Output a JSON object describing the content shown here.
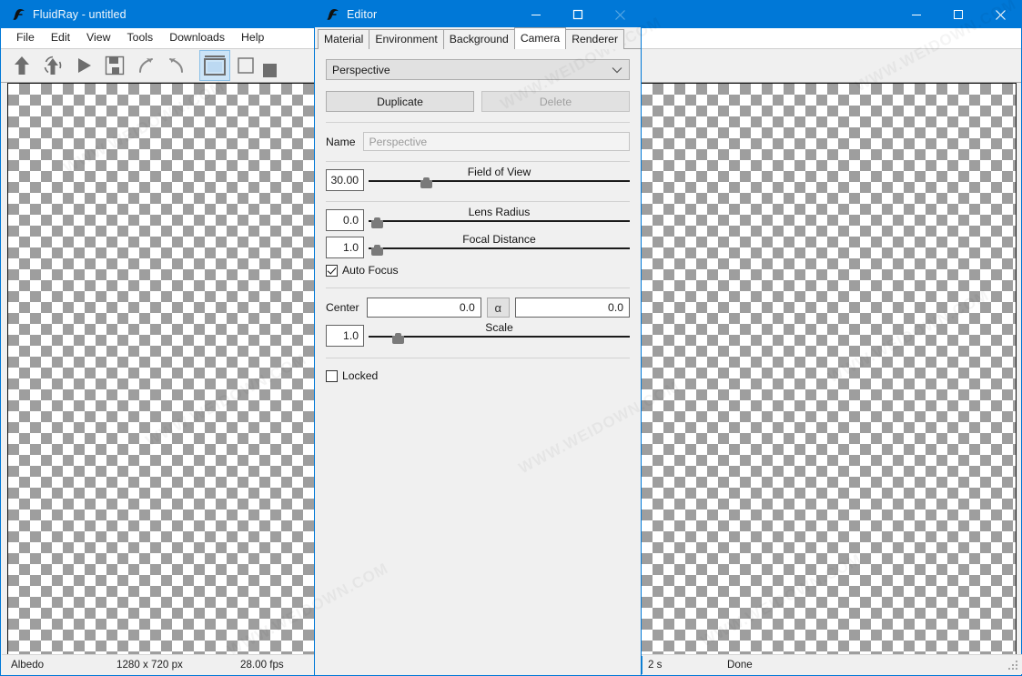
{
  "main_window": {
    "title": "FluidRay - untitled",
    "icon": "fluidray-logo-icon",
    "window_buttons": [
      {
        "name": "minimize-button",
        "glyph": "minimize-icon"
      },
      {
        "name": "maximize-button",
        "glyph": "maximize-icon"
      },
      {
        "name": "close-button",
        "glyph": "close-icon"
      }
    ],
    "menu": [
      "File",
      "Edit",
      "View",
      "Tools",
      "Downloads",
      "Help"
    ],
    "toolbar": [
      {
        "name": "upload-button",
        "icon": "up-arrow-icon",
        "selected": false
      },
      {
        "name": "reload-button",
        "icon": "refresh-arrow-icon",
        "selected": false
      },
      {
        "name": "render-button",
        "icon": "play-icon",
        "selected": false
      },
      {
        "name": "save-button",
        "icon": "floppy-disk-icon",
        "selected": false
      },
      {
        "name": "undo-button",
        "icon": "undo-arrow-icon",
        "selected": false
      },
      {
        "name": "redo-button",
        "icon": "redo-arrow-icon",
        "selected": false
      },
      {
        "name": "fit-view-button",
        "icon": "window-frame-icon",
        "selected": true
      },
      {
        "name": "region-button",
        "icon": "square-outline-icon",
        "selected": false
      },
      {
        "name": "swatch-button",
        "icon": "filled-square-icon",
        "selected": false
      }
    ],
    "status_bar": {
      "channel": "Albedo",
      "resolution": "1280 x 720 px",
      "fps": "28.00 fps",
      "elapsed": "2 s",
      "state": "Done"
    }
  },
  "editor_window": {
    "title": "Editor",
    "icon": "fluidray-logo-icon",
    "window_buttons": [
      {
        "name": "minimize-button",
        "glyph": "minimize-icon"
      },
      {
        "name": "maximize-button",
        "glyph": "maximize-icon"
      },
      {
        "name": "close-button",
        "glyph": "close-icon"
      }
    ],
    "tabs": [
      {
        "label": "Material",
        "active": false
      },
      {
        "label": "Environment",
        "active": false
      },
      {
        "label": "Background",
        "active": false
      },
      {
        "label": "Camera",
        "active": true
      },
      {
        "label": "Renderer",
        "active": false
      }
    ],
    "camera_panel": {
      "preset_select": {
        "value": "Perspective",
        "chevron": "chevron-down-icon"
      },
      "duplicate_label": "Duplicate",
      "delete_label": "Delete",
      "name_label": "Name",
      "name_placeholder": "Perspective",
      "name_value": "",
      "field_of_view": {
        "label": "Field of View",
        "value": "30.00",
        "thumb_pct": 20
      },
      "lens_radius": {
        "label": "Lens Radius",
        "value": "0.0",
        "thumb_pct": 1
      },
      "focal_distance": {
        "label": "Focal Distance",
        "value": "1.0",
        "thumb_pct": 1
      },
      "auto_focus": {
        "label": "Auto Focus",
        "checked": true
      },
      "center": {
        "label": "Center",
        "x_value": "0.0",
        "y_value": "0.0",
        "link_button": "α"
      },
      "scale": {
        "label": "Scale",
        "value": "1.0",
        "thumb_pct": 9
      },
      "locked": {
        "label": "Locked",
        "checked": false
      }
    }
  },
  "colors": {
    "titlebar": "#0078d7",
    "panel_bg": "#f0f0f0",
    "accent_selected": "#cce4f7",
    "checker_dark": "#9e9e9e",
    "checker_light": "#ffffff"
  },
  "watermarks": [
    "WWW.WEIDOWN.COM",
    "WWW.WEIDOWN.COM",
    "WWW.WEIDOWN.COM",
    "WWW.WEIDOWN.COM",
    "WWW.WEIDOWN.COM",
    "WWW.WEIDOWN.COM",
    "WWW.WEIDOWN.COM",
    "WWW.WEIDOWN.COM"
  ]
}
